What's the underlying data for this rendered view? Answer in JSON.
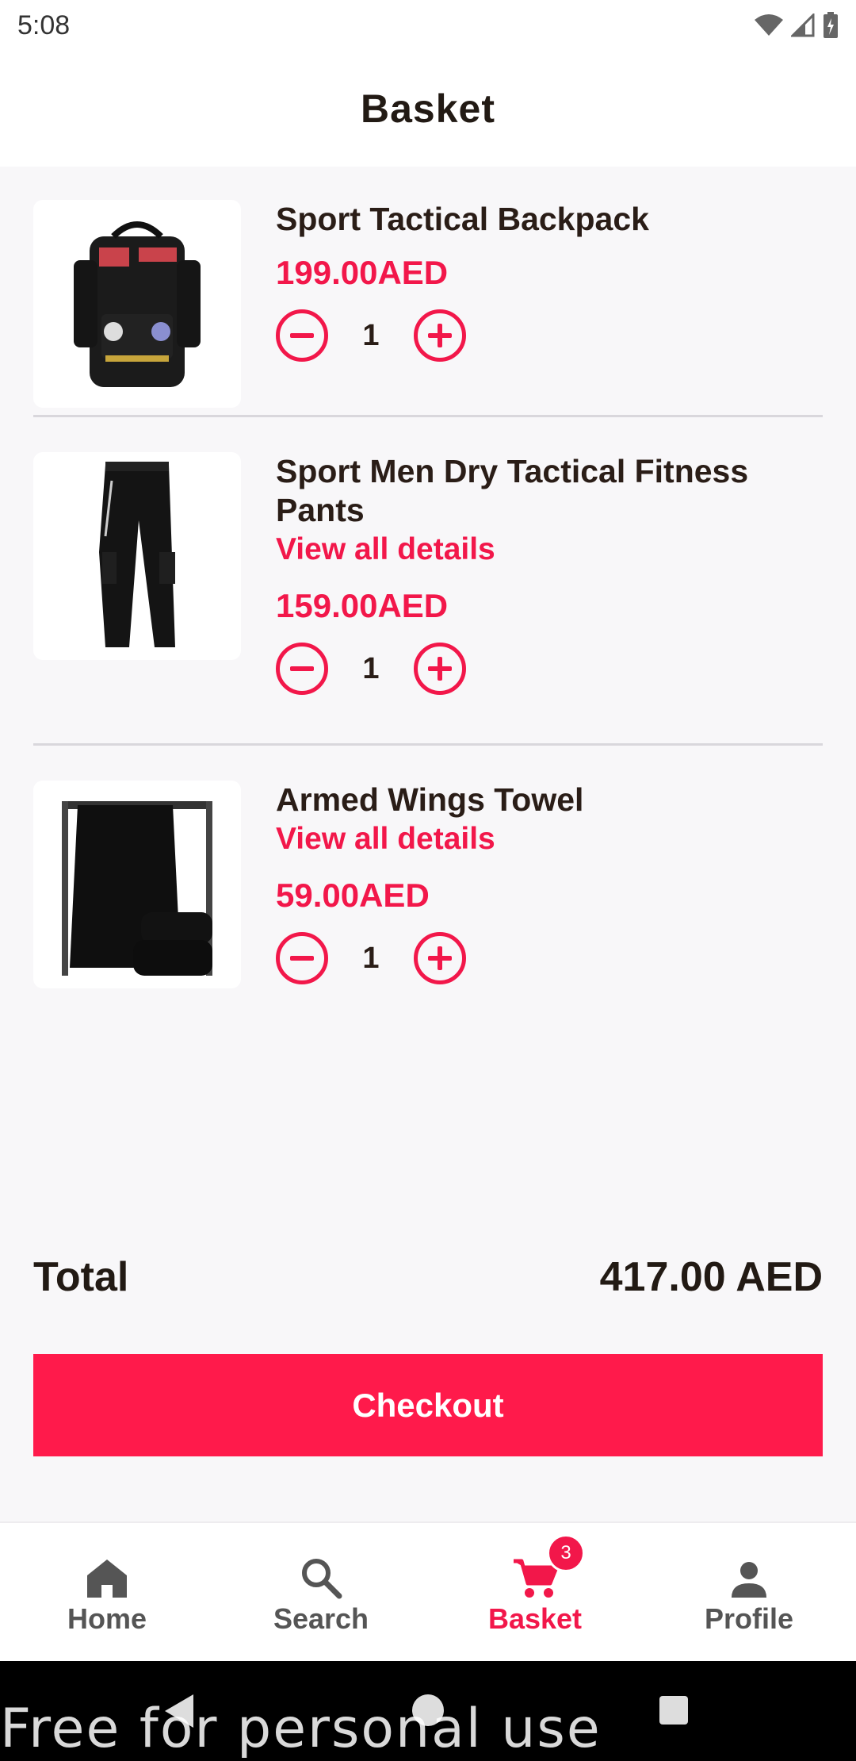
{
  "status_bar": {
    "time": "5:08"
  },
  "header": {
    "title": "Basket"
  },
  "items": [
    {
      "name": "Sport Tactical Backpack",
      "details_link": "",
      "price": "199.00AED",
      "quantity": "1"
    },
    {
      "name": "Sport Men Dry Tactical Fitness Pants",
      "details_link": "View all details",
      "price": "159.00AED",
      "quantity": "1"
    },
    {
      "name": "Armed Wings Towel",
      "details_link": "View all details",
      "price": "59.00AED",
      "quantity": "1"
    }
  ],
  "total": {
    "label": "Total",
    "value": "417.00 AED"
  },
  "checkout_label": "Checkout",
  "nav": {
    "items": [
      {
        "label": "Home",
        "icon": "home-icon"
      },
      {
        "label": "Search",
        "icon": "search-icon"
      },
      {
        "label": "Basket",
        "icon": "cart-icon",
        "badge": "3",
        "active": true
      },
      {
        "label": "Profile",
        "icon": "person-icon"
      }
    ]
  },
  "watermark": "Free for personal use",
  "colors": {
    "accent": "#f2174a",
    "button": "#ff1a4b",
    "text": "#2a1d17",
    "background": "#f8f7f9"
  }
}
